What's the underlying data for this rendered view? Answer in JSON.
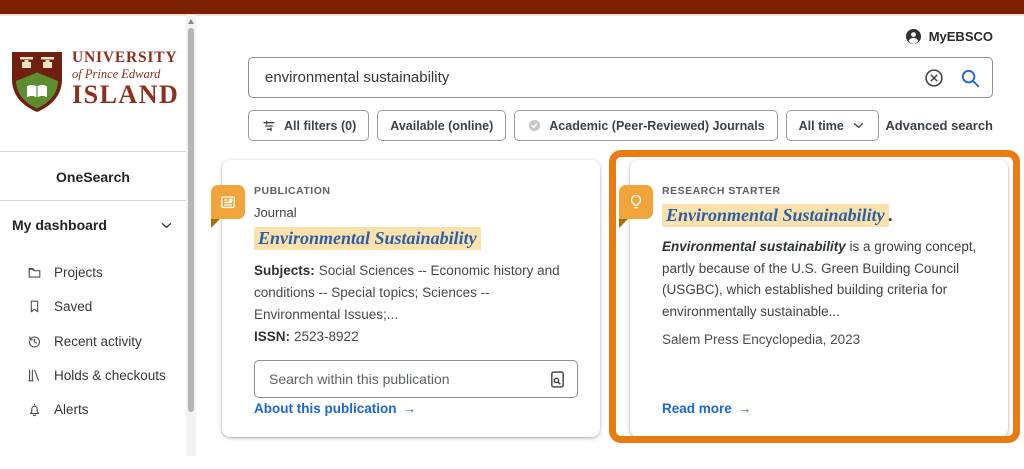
{
  "header": {
    "account_label": "MyEBSCO"
  },
  "branding": {
    "line1": "UNIVERSITY",
    "line2": "of Prince Edward",
    "line3": "ISLAND"
  },
  "sidebar": {
    "search_mode_label": "OneSearch",
    "dashboard_label": "My dashboard",
    "items": [
      {
        "label": "Projects",
        "icon": "folder-icon"
      },
      {
        "label": "Saved",
        "icon": "bookmark-icon"
      },
      {
        "label": "Recent activity",
        "icon": "history-icon"
      },
      {
        "label": "Holds & checkouts",
        "icon": "books-icon"
      },
      {
        "label": "Alerts",
        "icon": "bell-icon"
      }
    ]
  },
  "search": {
    "query": "environmental sustainability"
  },
  "filters": {
    "all_filters_label": "All filters (0)",
    "available_label": "Available (online)",
    "academic_label": "Academic (Peer-Reviewed) Journals",
    "time_label": "All time",
    "advanced_label": "Advanced search"
  },
  "publication_card": {
    "kicker": "PUBLICATION",
    "record_type": "Journal",
    "title": "Environmental Sustainability",
    "subjects_label": "Subjects:",
    "subjects_value": "Social Sciences -- Economic history and conditions -- Special topics; Sciences -- Environmental Issues;...",
    "issn_label": "ISSN:",
    "issn_value": "2523-8922",
    "search_placeholder": "Search within this publication",
    "link_label": "About this publication"
  },
  "research_starter_card": {
    "kicker": "RESEARCH STARTER",
    "title": "Environmental Sustainability",
    "title_period": ".",
    "snippet_lead": "Environmental sustainability",
    "snippet_rest": " is a growing concept, partly because of the U.S. Green Building Council (USGBC), which established building criteria for environmentally sustainable...",
    "source_line": "Salem Press Encyclopedia, 2023",
    "link_label": "Read more"
  },
  "icons": {
    "arrow_right": "→"
  },
  "colors": {
    "brand_maroon": "#7A2000",
    "logo_red": "#8F2F1E",
    "shield_green": "#5C8D2E",
    "badge_orange": "#F0A43A",
    "badge_fold": "#A86E05",
    "highlight_cream": "#FBE2AD",
    "annotation_orange": "#E87C12",
    "link_blue": "#1B66D1",
    "title_blue": "#2A5FA8"
  }
}
